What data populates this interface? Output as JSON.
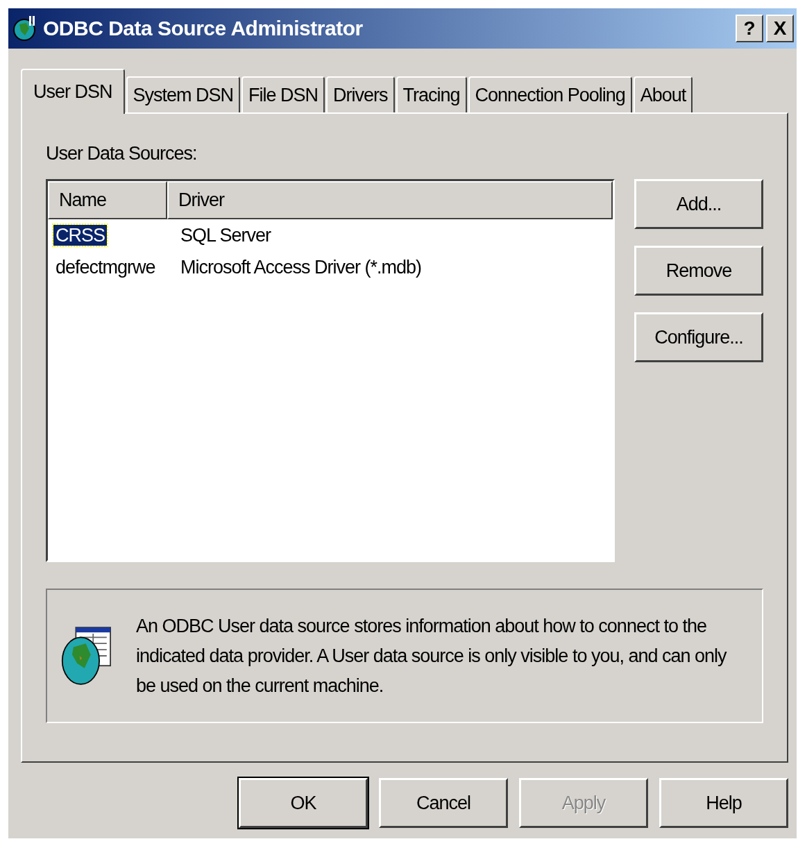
{
  "window": {
    "title": "ODBC Data Source Administrator",
    "title_buttons": [
      "?",
      "X"
    ]
  },
  "tabs": [
    {
      "label": "User DSN",
      "selected": true
    },
    {
      "label": "System DSN",
      "selected": false
    },
    {
      "label": "File DSN",
      "selected": false
    },
    {
      "label": "Drivers",
      "selected": false
    },
    {
      "label": "Tracing",
      "selected": false
    },
    {
      "label": "Connection Pooling",
      "selected": false
    },
    {
      "label": "About",
      "selected": false
    }
  ],
  "sources_label": "User Data Sources:",
  "table": {
    "columns": [
      "Name",
      "Driver"
    ],
    "rows": [
      {
        "cells": [
          "CRSS",
          "SQL Server"
        ],
        "selected": true
      },
      {
        "cells": [
          "defectmgrwe",
          "Microsoft Access Driver (*.mdb)"
        ],
        "selected": false
      }
    ]
  },
  "side_buttons": [
    {
      "label": "Add...",
      "disabled": false
    },
    {
      "label": "Remove",
      "disabled": false
    },
    {
      "label": "Configure...",
      "disabled": false
    }
  ],
  "info_text": "An ODBC User data source stores information about how to connect to the indicated data provider.   A User data source is only visible to you, and can only be used on the current machine.",
  "buttons": [
    {
      "label": "OK",
      "default": true,
      "disabled": false
    },
    {
      "label": "Cancel",
      "default": false,
      "disabled": false
    },
    {
      "label": "Apply",
      "default": false,
      "disabled": true
    },
    {
      "label": "Help",
      "default": false,
      "disabled": false
    }
  ]
}
